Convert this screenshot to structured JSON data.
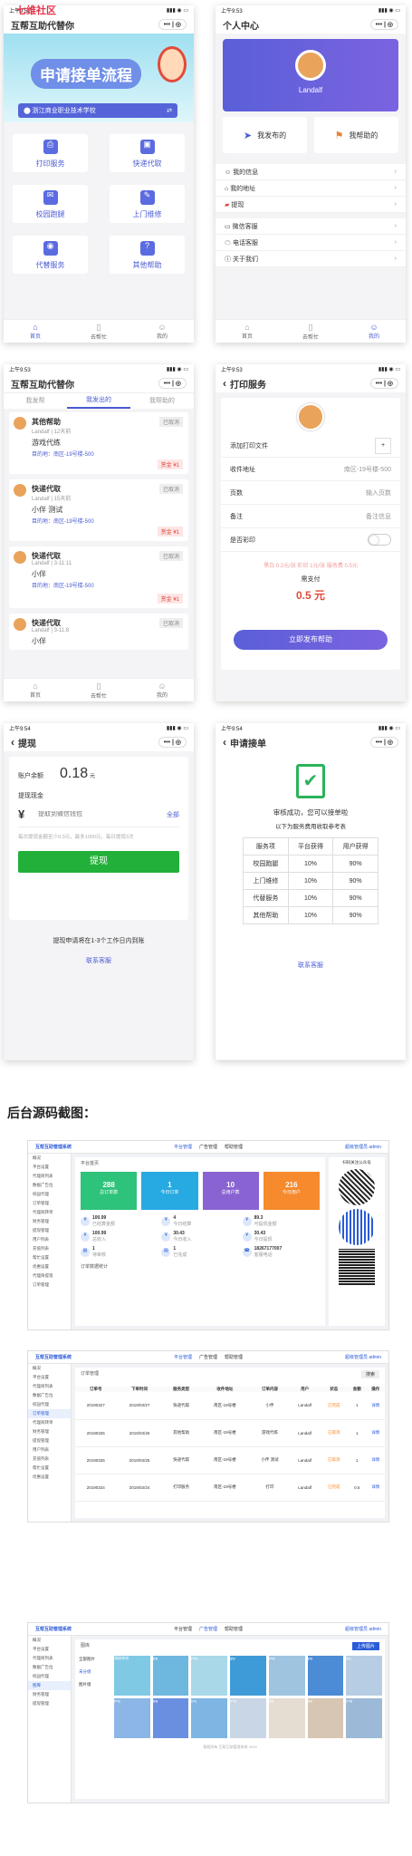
{
  "watermark": "七维社区",
  "s1": {
    "time": "上午9:52",
    "title": "互帮互助代替你",
    "banner": "申请接单流程",
    "school": "浙江商业职业技术学校",
    "grid": [
      {
        "label": "打印服务",
        "icon": "printer-icon",
        "c": "#4a5bd4"
      },
      {
        "label": "快递代取",
        "icon": "package-icon",
        "c": "#4a5bd4"
      },
      {
        "label": "校园跑腿",
        "icon": "envelope-icon",
        "c": "#4a5bd4"
      },
      {
        "label": "上门维修",
        "icon": "tools-icon",
        "c": "#4a5bd4"
      },
      {
        "label": "代替服务",
        "icon": "eye-icon",
        "c": "#4a5bd4"
      },
      {
        "label": "其他帮助",
        "icon": "help-icon",
        "c": "#4a5bd4"
      }
    ]
  },
  "tabs": {
    "home": "首页",
    "help": "去帮忙",
    "mine": "我的"
  },
  "s2": {
    "time": "上午9:53",
    "title": "个人中心",
    "user": "Landalf",
    "posted": "我发布的",
    "helped": "我帮助的",
    "menu": [
      "我的信息",
      "我的地址",
      "提现",
      "微信客服",
      "电话客服",
      "关于我们"
    ]
  },
  "s3": {
    "time": "上午9:53",
    "title": "互帮互助代替你",
    "tabs": [
      "我发帮",
      "我发出的",
      "我帮助的"
    ],
    "orders": [
      {
        "type": "其他帮助",
        "meta": "Landalf | 12天前",
        "desc": "游戏代练",
        "addr": "目的地：南区-19号楼-500",
        "status": "已取消",
        "price": "赏金 ¥1"
      },
      {
        "type": "快递代取",
        "meta": "Landalf | 15天前",
        "desc": "小伴 测试",
        "addr": "目的地：南区-19号楼-500",
        "status": "已取消",
        "price": "赏金 ¥1"
      },
      {
        "type": "快递代取",
        "meta": "Landalf | 3-11:11",
        "desc": "小伴",
        "addr": "目的地：南区-19号楼-500",
        "status": "已取消",
        "price": "赏金 ¥1"
      },
      {
        "type": "快递代取",
        "meta": "Landalf | 3-11:8",
        "desc": "小伴",
        "addr": "",
        "status": "已取消",
        "price": ""
      }
    ]
  },
  "s4": {
    "time": "上午9:53",
    "title": "打印服务",
    "add": "添加打印文件",
    "rows": [
      {
        "k": "收件地址",
        "v": "南区-19号楼-500"
      },
      {
        "k": "页数",
        "v": "输入页数"
      },
      {
        "k": "备注",
        "v": "备注信息"
      },
      {
        "k": "是否彩印",
        "v": ""
      }
    ],
    "price_note": "黑白 0.2元/张 彩印 1元/张 服务费 0.5元",
    "pay_label": "需支付",
    "pay": "0.5 元",
    "submit": "立即发布帮助"
  },
  "s5": {
    "time": "上午9:54",
    "title": "提现",
    "bal_label": "账户余额",
    "bal": "0.18",
    "unit": "元",
    "cash_label": "提现现金",
    "currency": "¥",
    "placeholder": "提取到微信钱包",
    "all": "全部",
    "rule": "每次提现金额至少0.3元，最多1000元，每日提现3次",
    "btn": "提现",
    "note": "提现申请将在1-3个工作日内到账",
    "cs": "联系客服"
  },
  "s6": {
    "time": "上午9:54",
    "title": "申请接单",
    "ok": "审核成功，您可以接单啦",
    "sub": "以下为服务费用收取参考表",
    "head": [
      "服务项",
      "平台获得",
      "用户获得"
    ],
    "table": [
      [
        "校园跑腿",
        "10%",
        "90%"
      ],
      [
        "上门维修",
        "10%",
        "90%"
      ],
      [
        "代替服务",
        "10%",
        "90%"
      ],
      [
        "其他帮助",
        "10%",
        "90%"
      ]
    ],
    "cs": "联系客服"
  },
  "section": "后台源码截图：",
  "a1": {
    "brand": "互帮互助管理系统",
    "tabs": [
      "平台管理",
      "广告管理",
      "帮助管理"
    ],
    "admin": "超级管理员 admin",
    "menu": [
      "概况",
      "平台设置",
      "代理商列表",
      "数据广告位",
      "校园代理",
      "订单管理",
      "代理商转单",
      "财务管理",
      "提现管理",
      "用户列表",
      "充值列表",
      "帮忙设置",
      "优惠设置",
      "代理商提现",
      "订单管理"
    ],
    "crumb": "平台首页",
    "stats": [
      {
        "n": "288",
        "t": "总订单数",
        "c": "#2ec37a"
      },
      {
        "n": "1",
        "t": "今日订单",
        "c": "#27a9e1"
      },
      {
        "n": "10",
        "t": "总用户数",
        "c": "#8a63d2"
      },
      {
        "n": "216",
        "t": "今日用户",
        "c": "#f68a2d"
      }
    ],
    "fin": [
      [
        "100.99",
        "已结算金额"
      ],
      [
        "4",
        "今日结算"
      ],
      [
        "89.3",
        "可提现金额"
      ],
      [
        "100.99",
        "总收入"
      ],
      [
        "30.43",
        "今日收入"
      ],
      [
        "30.43",
        "今日提现"
      ],
      [
        "1",
        "待审核"
      ],
      [
        "1",
        "已完成"
      ],
      [
        "18267177007",
        "客服电话"
      ]
    ],
    "qr_title": "扫码关注公众号",
    "chart_title": "订单数据统计"
  },
  "a2": {
    "brand": "互帮互助管理系统",
    "crumb": "订单管理",
    "search": "搜索",
    "cols": [
      "订单号",
      "下单时间",
      "服务类型",
      "收件地址",
      "订单内容",
      "用户",
      "状态",
      "金额",
      "操作"
    ],
    "rows": [
      [
        "20190327",
        "2019/03/27",
        "快递代取",
        "南区-19号楼",
        "小伴",
        "Landalf",
        "已完成",
        "1",
        "详情"
      ],
      [
        "20190326",
        "2019/03/26",
        "其他帮助",
        "南区-19号楼",
        "游戏代练",
        "Landalf",
        "已取消",
        "1",
        "详情"
      ],
      [
        "20190325",
        "2019/03/25",
        "快递代取",
        "南区-19号楼",
        "小伴 测试",
        "Landalf",
        "已取消",
        "1",
        "详情"
      ],
      [
        "20190324",
        "2019/03/24",
        "打印服务",
        "南区-19号楼",
        "打印",
        "Landalf",
        "已完成",
        "0.5",
        "详情"
      ]
    ]
  },
  "a3": {
    "brand": "互帮互助管理系统",
    "crumb": "图库",
    "upload": "上传图片",
    "groups": [
      "全部图片",
      "未分组",
      "图片组"
    ],
    "tiles": [
      "请接单流",
      "jpg",
      "png",
      "jpg",
      "png",
      "jpg",
      "jpg",
      "png",
      "jpg",
      "jpg",
      "png",
      "jpg",
      "jpg",
      "png"
    ],
    "footer": "版权所有 互帮互助管理系统 2019"
  }
}
